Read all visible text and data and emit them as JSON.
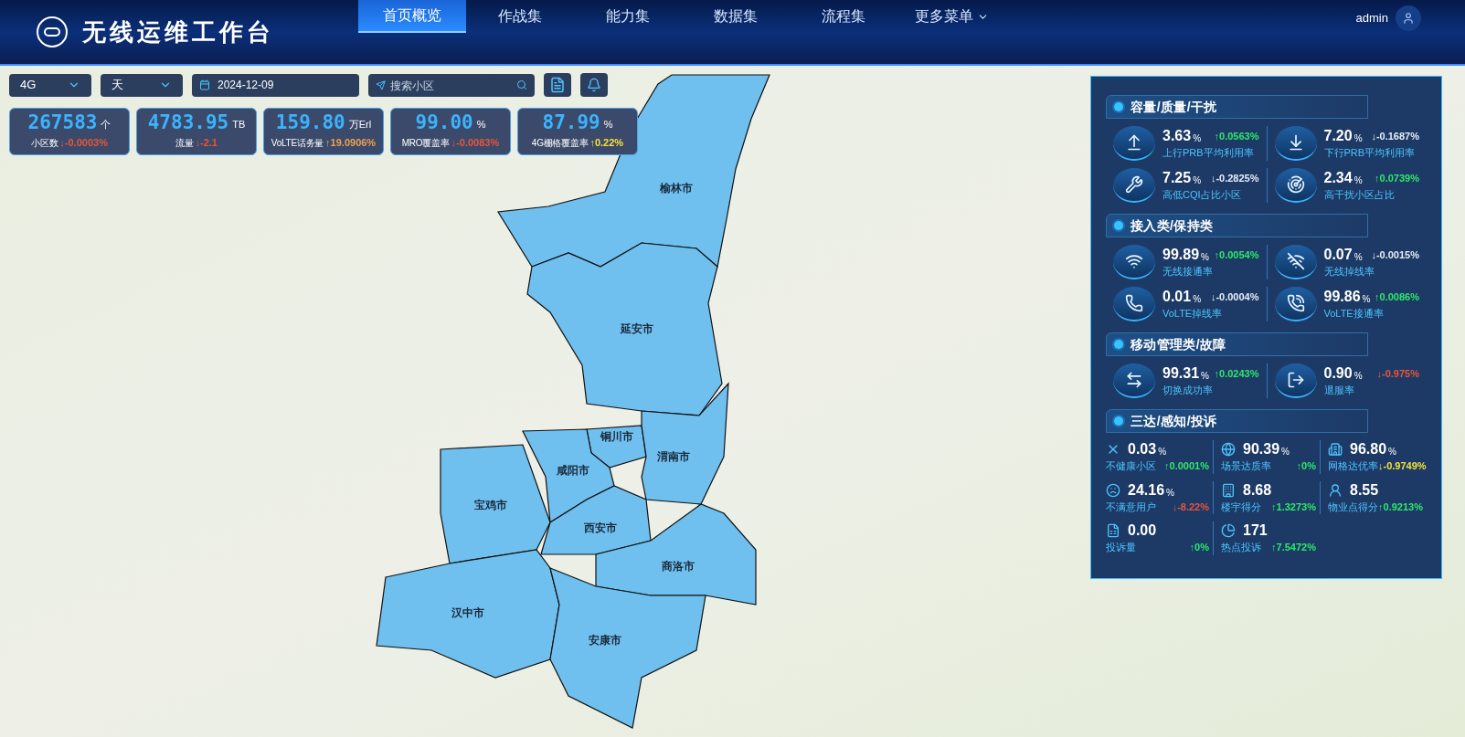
{
  "header": {
    "title": "无线运维工作台",
    "nav": [
      {
        "label": "首页概览",
        "selected": true
      },
      {
        "label": "作战集",
        "selected": false
      },
      {
        "label": "能力集",
        "selected": false
      },
      {
        "label": "数据集",
        "selected": false
      },
      {
        "label": "流程集",
        "selected": false
      },
      {
        "label": "更多菜单",
        "selected": false,
        "dropdown": true
      }
    ],
    "user": "admin"
  },
  "filters": {
    "network": "4G",
    "period": "天",
    "date": "2024-12-09",
    "search": {
      "placeholder": "搜索小区"
    }
  },
  "kpis": [
    {
      "value": "267583",
      "unit": "个",
      "label": "小区数",
      "change": "↓-0.0003%",
      "color": "#e8553a"
    },
    {
      "value": "4783.95",
      "unit": "TB",
      "label": "流量",
      "change": "↓-2.1",
      "color": "#e8553a"
    },
    {
      "value": "159.80",
      "unit": "万Erl",
      "label": "VoLTE话务量",
      "change": "↑19.0906%",
      "color": "#f0a050"
    },
    {
      "value": "99.00",
      "unit": "%",
      "label": "MRO覆盖率",
      "change": "↓-0.0083%",
      "color": "#e8553a"
    },
    {
      "value": "87.99",
      "unit": "%",
      "label": "4G栅格覆盖率",
      "change": "↑0.22%",
      "color": "#f5e13a"
    }
  ],
  "map": {
    "regions": [
      {
        "name": "榆林市"
      },
      {
        "name": "延安市"
      },
      {
        "name": "铜川市"
      },
      {
        "name": "渭南市"
      },
      {
        "name": "咸阳市"
      },
      {
        "name": "宝鸡市"
      },
      {
        "name": "西安市"
      },
      {
        "name": "商洛市"
      },
      {
        "name": "汉中市"
      },
      {
        "name": "安康市"
      }
    ]
  },
  "panel": {
    "sections": [
      {
        "title": "容量/质量/干扰",
        "kind": "pairs",
        "items": [
          {
            "value": "3.63",
            "unit": "%",
            "label": "上行PRB平均利用率",
            "change": "↑0.0563%",
            "color": "#2ee86a"
          },
          {
            "value": "7.20",
            "unit": "%",
            "label": "下行PRB平均利用率",
            "change": "↓-0.1687%",
            "color": "#e6eef8"
          },
          {
            "value": "7.25",
            "unit": "%",
            "label": "高低CQI占比小区",
            "change": "↓-0.2825%",
            "color": "#e6eef8"
          },
          {
            "value": "2.34",
            "unit": "%",
            "label": "高干扰小区占比",
            "change": "↑0.0739%",
            "color": "#2ee86a"
          }
        ]
      },
      {
        "title": "接入类/保持类",
        "kind": "pairs",
        "items": [
          {
            "value": "99.89",
            "unit": "%",
            "label": "无线接通率",
            "change": "↑0.0054%",
            "color": "#2ee86a"
          },
          {
            "value": "0.07",
            "unit": "%",
            "label": "无线掉线率",
            "change": "↓-0.0015%",
            "color": "#e6eef8"
          },
          {
            "value": "0.01",
            "unit": "%",
            "label": "VoLTE掉线率",
            "change": "↓-0.0004%",
            "color": "#e6eef8"
          },
          {
            "value": "99.86",
            "unit": "%",
            "label": "VoLTE接通率",
            "change": "↑0.0086%",
            "color": "#2ee86a"
          }
        ]
      },
      {
        "title": "移动管理类/故障",
        "kind": "pairs",
        "items": [
          {
            "value": "99.31",
            "unit": "%",
            "label": "切换成功率",
            "change": "↑0.0243%",
            "color": "#2ee86a"
          },
          {
            "value": "0.90",
            "unit": "%",
            "label": "退服率",
            "change": "↓-0.975%",
            "color": "#e8553a"
          }
        ]
      },
      {
        "title": "三达/感知/投诉",
        "kind": "grid",
        "items": [
          {
            "value": "0.03",
            "unit": "%",
            "label": "不健康小区",
            "change": "↑0.0001%",
            "color": "#2ee86a"
          },
          {
            "value": "90.39",
            "unit": "%",
            "label": "场景达质率",
            "change": "↑0%",
            "color": "#2ee86a"
          },
          {
            "value": "96.80",
            "unit": "%",
            "label": "网格达优率",
            "change": "↓-0.9749%",
            "color": "#f5e13a"
          },
          {
            "value": "24.16",
            "unit": "%",
            "label": "不满意用户",
            "change": "↓-8.22%",
            "color": "#e8553a"
          },
          {
            "value": "8.68",
            "label": "楼宇得分",
            "change": "↑1.3273%",
            "color": "#2ee86a"
          },
          {
            "value": "8.55",
            "label": "物业点得分",
            "change": "↑0.9213%",
            "color": "#2ee86a"
          },
          {
            "value": "0.00",
            "label": "投诉量",
            "change": "↑0%",
            "color": "#2ee86a"
          },
          {
            "value": "171",
            "label": "热点投诉",
            "change": "↑7.5472%",
            "color": "#2ee86a"
          }
        ]
      }
    ]
  }
}
